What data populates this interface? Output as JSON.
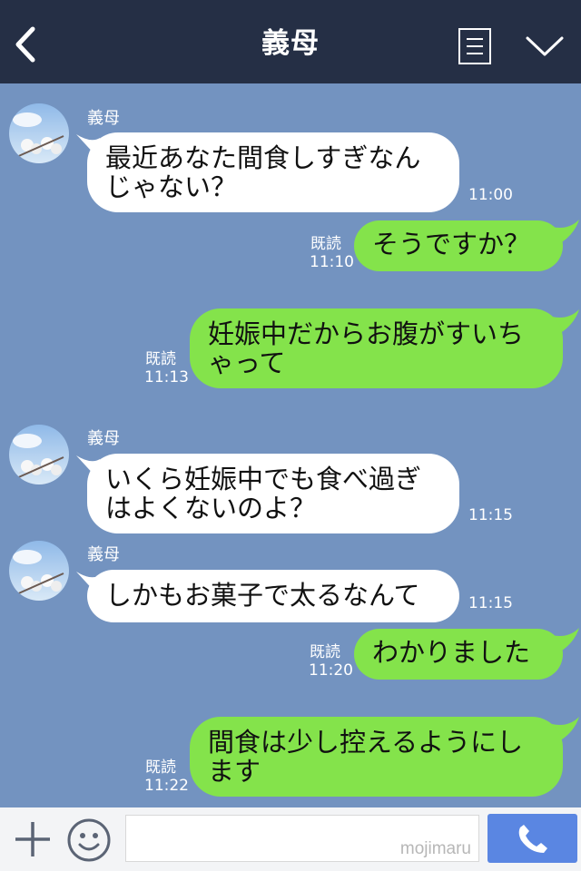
{
  "header": {
    "title": "義母"
  },
  "messages": [
    {
      "type": "in",
      "sender": "義母",
      "lines": [
        "最近あなた間食しすぎなん",
        "じゃない？"
      ],
      "time": "11:00"
    },
    {
      "type": "out",
      "read": "既読",
      "time": "11:10",
      "lines": [
        "そうですか？"
      ]
    },
    {
      "type": "out",
      "read": "既読",
      "time": "11:13",
      "lines": [
        "妊娠中だからお腹がすいち",
        "ゃって"
      ]
    },
    {
      "type": "in",
      "sender": "義母",
      "lines": [
        "いくら妊娠中でも食べ過ぎ",
        "はよくないのよ？"
      ],
      "time": "11:15"
    },
    {
      "type": "in",
      "sender": "義母",
      "lines": [
        "しかもお菓子で太るなんて"
      ],
      "time": "11:15"
    },
    {
      "type": "out",
      "read": "既読",
      "time": "11:20",
      "lines": [
        "わかりました"
      ]
    },
    {
      "type": "out",
      "read": "既読",
      "time": "11:22",
      "lines": [
        "間食は少し控えるようにし",
        "ます"
      ]
    }
  ],
  "footer": {
    "watermark": "mojimaru"
  },
  "colors": {
    "header": "#252f45",
    "background": "#7393c0",
    "outgoing": "#84e34b",
    "incoming": "#ffffff",
    "send": "#5a86e2"
  },
  "icons": [
    "back-arrow-icon",
    "menu-list-icon",
    "chevron-down-icon",
    "plus-icon",
    "emoji-icon",
    "phone-icon"
  ]
}
